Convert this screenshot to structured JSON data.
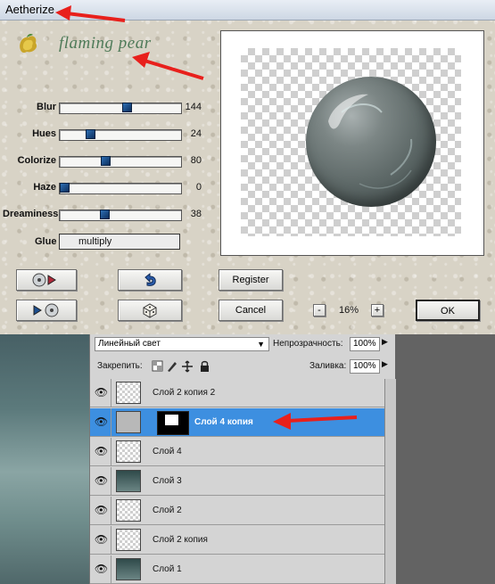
{
  "window": {
    "title": "Aetherize",
    "brand": "flaming pear"
  },
  "sliders": [
    {
      "label": "Blur",
      "value": "144",
      "position": 0.56
    },
    {
      "label": "Hues",
      "value": "24",
      "position": 0.23
    },
    {
      "label": "Colorize",
      "value": "80",
      "position": 0.37
    },
    {
      "label": "Haze",
      "value": "0",
      "position": 0.0
    },
    {
      "label": "Dreaminess",
      "value": "38",
      "position": 0.36
    }
  ],
  "glue": {
    "label": "Glue",
    "value": "multiply"
  },
  "buttons": {
    "register": "Register",
    "cancel": "Cancel",
    "ok": "OK"
  },
  "zoom": {
    "minus": "-",
    "value": "16%",
    "plus": "+"
  },
  "layers_panel": {
    "blend_mode": "Линейный свет",
    "opacity_label": "Непрозрачность:",
    "opacity_value": "100%",
    "lock_label": "Закрепить:",
    "fill_label": "Заливка:",
    "fill_value": "100%",
    "layers": [
      {
        "name": "Слой 2 копия 2",
        "selected": false
      },
      {
        "name": "Слой 4 копия",
        "selected": true
      },
      {
        "name": "Слой 4",
        "selected": false
      },
      {
        "name": "Слой 3",
        "selected": false
      },
      {
        "name": "Слой 2",
        "selected": false
      },
      {
        "name": "Слой 2 копия",
        "selected": false
      },
      {
        "name": "Слой 1",
        "selected": false
      }
    ]
  },
  "colors": {
    "accent_arrow": "#e8201c",
    "selected_layer": "#3d8fe0"
  }
}
